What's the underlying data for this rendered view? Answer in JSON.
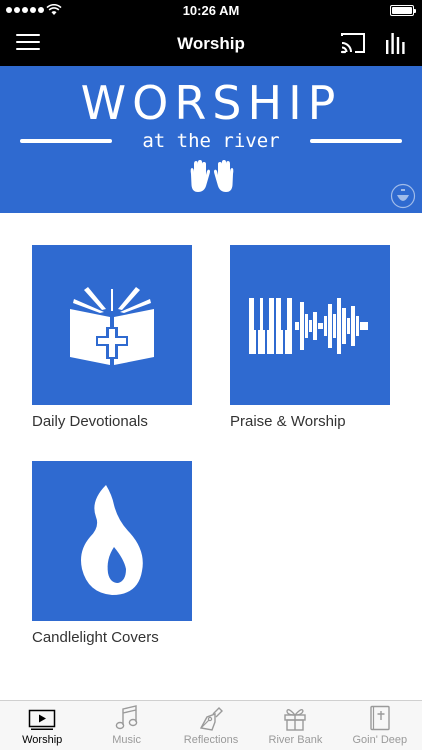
{
  "status_bar": {
    "time": "10:26 AM",
    "battery_level": 1.0
  },
  "nav_bar": {
    "title": "Worship"
  },
  "banner": {
    "headline": "WORSHIP",
    "subline": "at the river"
  },
  "tiles": [
    {
      "label": "Daily Devotionals",
      "icon": "open-bible-icon"
    },
    {
      "label": "Praise & Worship",
      "icon": "piano-soundwave-icon"
    },
    {
      "label": "Candlelight Covers",
      "icon": "flame-icon"
    }
  ],
  "tab_bar": {
    "active_index": 0,
    "tabs": [
      {
        "label": "Worship",
        "icon": "video-player-icon"
      },
      {
        "label": "Music",
        "icon": "music-note-icon"
      },
      {
        "label": "Reflections",
        "icon": "fountain-pen-icon"
      },
      {
        "label": "River Bank",
        "icon": "gift-icon"
      },
      {
        "label": "Goin' Deep",
        "icon": "bible-icon"
      }
    ]
  },
  "colors": {
    "brand_blue": "#2f6ad0",
    "bar_black": "#000000",
    "tab_inactive": "#9a9a9a"
  }
}
